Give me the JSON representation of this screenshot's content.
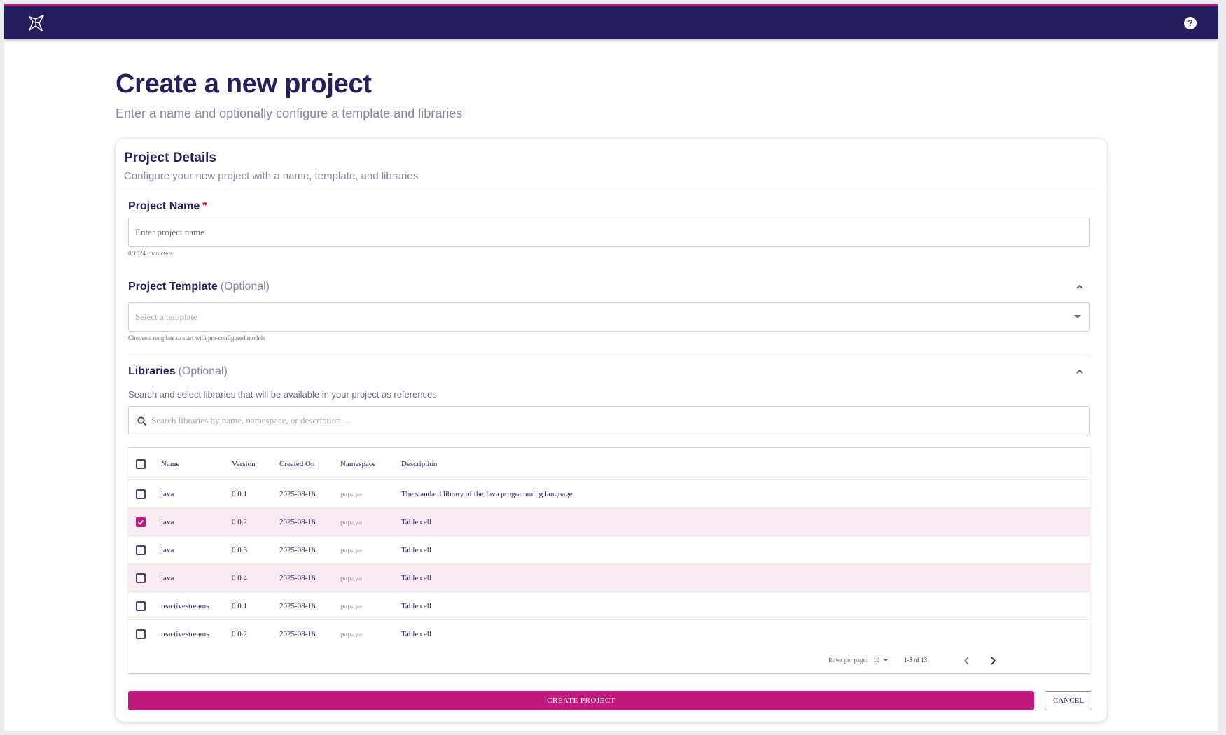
{
  "header": {
    "logo_icon": "star-logo-icon",
    "help_icon": "help-icon",
    "help_glyph": "?",
    "bar_color": "#241f5c",
    "accent_color": "#c0197b"
  },
  "page": {
    "title": "Create a new project",
    "subtitle": "Enter a name and optionally configure a template and libraries"
  },
  "card": {
    "title": "Project Details",
    "subtitle": "Configure your new project with a name, template, and libraries"
  },
  "project_name": {
    "label": "Project Name",
    "required_marker": "*",
    "placeholder": "Enter project name",
    "value": "",
    "helper": "0/1024 characters"
  },
  "template": {
    "label": "Project Template",
    "optional": "(Optional)",
    "placeholder": "Select a template",
    "helper": "Choose a template to start with pre-configured models"
  },
  "libraries": {
    "label": "Libraries",
    "optional": "(Optional)",
    "description": "Search and select libraries that will be available in your project as references",
    "search_placeholder": "Search libraries by name, namespace, or description...."
  },
  "table": {
    "columns": [
      "Name",
      "Version",
      "Created On",
      "Namespace",
      "Description"
    ],
    "rows": [
      {
        "name": "java",
        "version": "0.0.1",
        "created_on": "2025-08-18",
        "namespace": "papaya",
        "description": "The standard library of the Java programming language",
        "checked": false
      },
      {
        "name": "java",
        "version": "0.0.2",
        "created_on": "2025-08-18",
        "namespace": "papaya",
        "description": "Table cell",
        "checked": true
      },
      {
        "name": "java",
        "version": "0.0.3",
        "created_on": "2025-08-18",
        "namespace": "papaya",
        "description": "Table cell",
        "checked": false
      },
      {
        "name": "java",
        "version": "0.0.4",
        "created_on": "2025-08-18",
        "namespace": "papaya",
        "description": "Table cell",
        "checked": false
      },
      {
        "name": "reactivestreams",
        "version": "0.0.1",
        "created_on": "2025-08-18",
        "namespace": "papaya",
        "description": "Table cell",
        "checked": false
      },
      {
        "name": "reactivestreams",
        "version": "0.0.2",
        "created_on": "2025-08-18",
        "namespace": "papaya",
        "description": "Table cell",
        "checked": false
      }
    ],
    "pagination": {
      "rows_per_page_label": "Rows per page:",
      "rows_per_page": "10",
      "range": "1-5 of 13"
    }
  },
  "actions": {
    "create": "CREATE PROJECT",
    "cancel": "CANCEL"
  }
}
